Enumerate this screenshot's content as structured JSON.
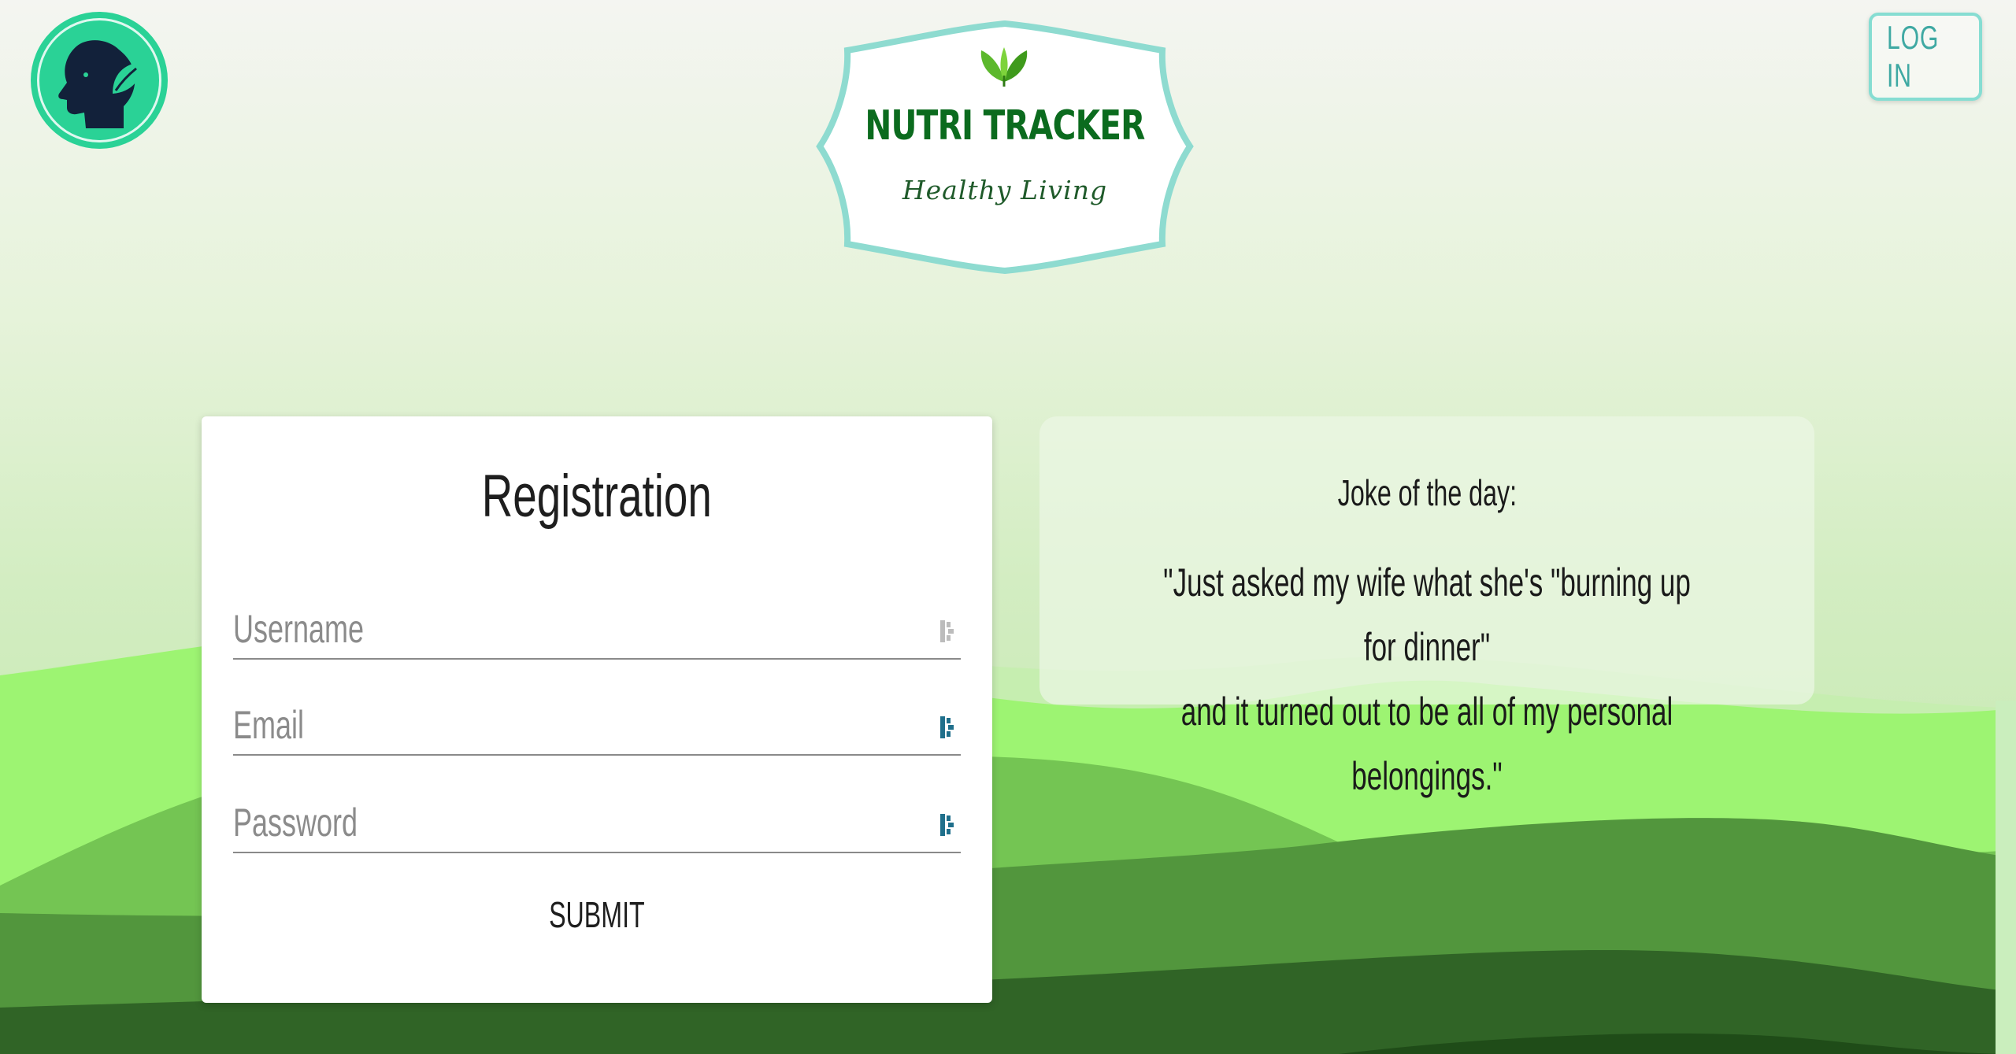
{
  "header": {
    "logo_title": "NUTRI TRACKER",
    "logo_subtitle": "Healthy Living",
    "login_label": "LOG IN"
  },
  "icons": {
    "avatar": "head-leaf-icon",
    "logo_leaf": "leaf-sprout-icon",
    "field_icon": "input-helper-icon"
  },
  "registration": {
    "title": "Registration",
    "fields": [
      {
        "placeholder": "Username",
        "value": ""
      },
      {
        "placeholder": "Email",
        "value": ""
      },
      {
        "placeholder": "Password",
        "value": ""
      }
    ],
    "submit_label": "SUBMIT"
  },
  "joke": {
    "title": "Joke of the day:",
    "line1": "\"Just asked my wife what she's \"burning up for dinner\"",
    "line2": "and it turned out to be all of my personal belongings.\""
  },
  "colors": {
    "accent_teal": "#86ddd2",
    "avatar_green": "#2ad296",
    "brand_green": "#0b6b1e"
  }
}
